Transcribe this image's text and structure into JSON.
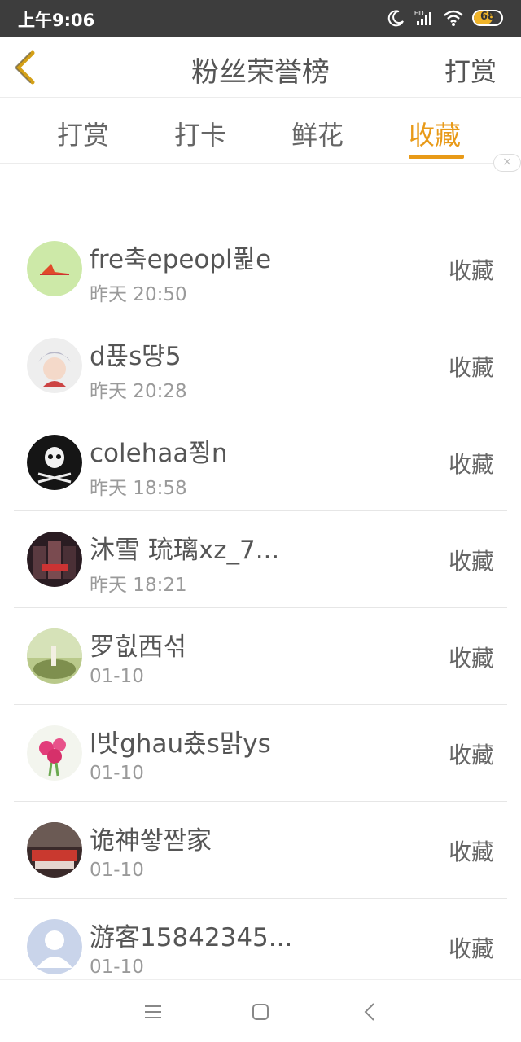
{
  "status_bar": {
    "time": "上午9:06",
    "battery": 68,
    "icons": [
      "moon-icon",
      "hd-signal-icon",
      "wifi-icon",
      "battery-icon"
    ]
  },
  "header": {
    "back_icon": "chevron-left-icon",
    "title": "粉丝荣誉榜",
    "action_label": "打赏",
    "accent_color": "#e89a18"
  },
  "tabs": [
    {
      "label": "打赏",
      "active": false
    },
    {
      "label": "打卡",
      "active": false
    },
    {
      "label": "鲜花",
      "active": false
    },
    {
      "label": "收藏",
      "active": true
    }
  ],
  "list": [
    {
      "name": "fre축epeopl퓙e",
      "time": "昨天 20:50",
      "action": "收藏"
    },
    {
      "name": "d푡s땽5",
      "time": "昨天 20:28",
      "action": "收藏"
    },
    {
      "name": "colehaa쬥n",
      "time": "昨天 18:58",
      "action": "收藏"
    },
    {
      "name": "沐雪 琉璃xz_7...",
      "time": "昨天 18:21",
      "action": "收藏"
    },
    {
      "name": "罗힚西섞",
      "time": "01-10",
      "action": "收藏"
    },
    {
      "name": "l밧ghau춌s맑ys",
      "time": "01-10",
      "action": "收藏"
    },
    {
      "name": "诡神쐏짣家",
      "time": "01-10",
      "action": "收藏"
    },
    {
      "name": "游客15842345...",
      "time": "01-10",
      "action": "收藏"
    }
  ],
  "nav_bar": [
    "menu-icon",
    "home-square-icon",
    "back-triangle-icon"
  ]
}
